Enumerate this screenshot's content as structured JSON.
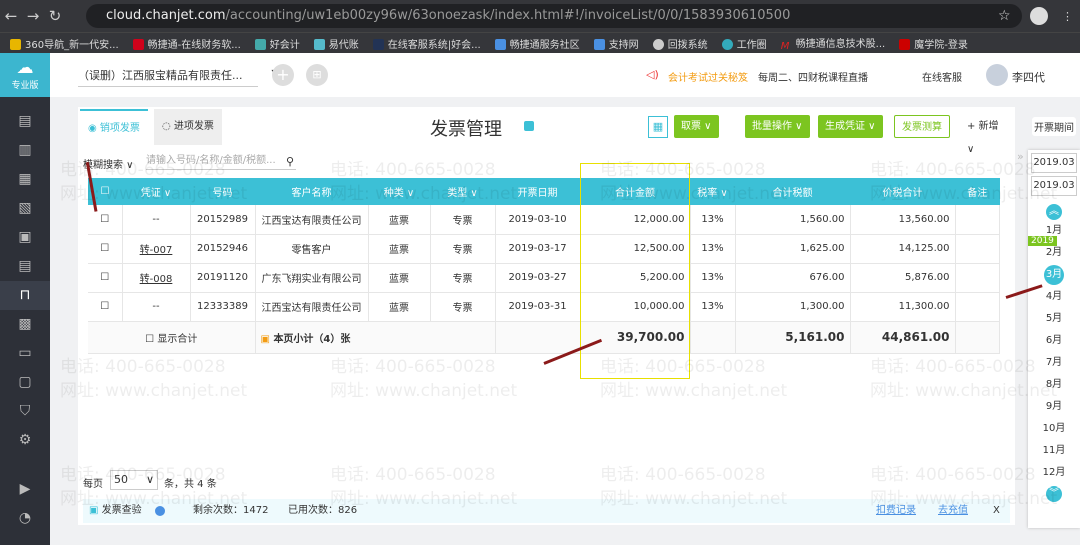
{
  "browser": {
    "url_host": "cloud.chanjet.com",
    "url_path": "/accounting/uw1eb00zy96w/63onoezask/index.html#!/invoiceList/0/0/1583930610500",
    "bookmarks": [
      "360导航_新一代安...",
      "畅捷通-在线财务软...",
      "好会计",
      "易代账",
      "在线客服系统|好会...",
      "畅捷通服务社区",
      "支持网",
      "回拨系统",
      "工作圈",
      "畅捷通信息技术股...",
      "魔学院-登录"
    ]
  },
  "app": {
    "edition": "专业版",
    "company": "（误删）江西服宝精品有限责任...",
    "promo1": "会计考试过关秘笈",
    "promo2": "每周二、四财税课程直播",
    "service": "在线客服",
    "user": "李四代"
  },
  "page": {
    "title": "发票管理",
    "tabs": [
      "销项发票",
      "进项发票"
    ],
    "buttons": {
      "fetch": "取票 ∨",
      "batch": "批量操作 ∨",
      "voucher": "生成凭证 ∨",
      "calc": "发票测算",
      "add": "+ 新增 ∨"
    },
    "search_label": "模糊搜索 ∨",
    "search_placeholder": "请输入号码/名称/金额/税额..."
  },
  "table": {
    "headers": [
      "凭证 ∨",
      "号码",
      "客户名称",
      "种类 ∨",
      "类型 ∨",
      "开票日期",
      "合计金额",
      "税率 ∨",
      "合计税额",
      "价税合计",
      "备注"
    ],
    "rows": [
      [
        "--",
        "20152989",
        "江西宝达有限责任公司",
        "蓝票",
        "专票",
        "2019-03-10",
        "12,000.00",
        "13%",
        "1,560.00",
        "13,560.00",
        ""
      ],
      [
        "转-007",
        "20152946",
        "零售客户",
        "蓝票",
        "专票",
        "2019-03-17",
        "12,500.00",
        "13%",
        "1,625.00",
        "14,125.00",
        ""
      ],
      [
        "转-008",
        "20191120",
        "广东飞翔实业有限公司",
        "蓝票",
        "专票",
        "2019-03-27",
        "5,200.00",
        "13%",
        "676.00",
        "5,876.00",
        ""
      ],
      [
        "--",
        "12333389",
        "江西宝达有限责任公司",
        "蓝票",
        "专票",
        "2019-03-31",
        "10,000.00",
        "13%",
        "1,300.00",
        "11,300.00",
        ""
      ]
    ],
    "show_total": "显示合计",
    "subtotal_label": "本页小计（4）张",
    "subtotal_amount": "39,700.00",
    "subtotal_tax": "5,161.00",
    "subtotal_total": "44,861.00"
  },
  "pager": {
    "per_page_label": "每页",
    "per_page": "50",
    "count": "条，共 4 条"
  },
  "footer": {
    "check": "发票查验",
    "remaining": "剩余次数：1472",
    "used": "已用次数：826",
    "record": "扣费记录",
    "recharge": "去充值",
    "close": "X"
  },
  "dates": {
    "label": "开票期间",
    "from": "2019.03",
    "to": "2019.03",
    "year": "2019",
    "months": [
      "1月",
      "2月",
      "3月",
      "4月",
      "5月",
      "6月",
      "7月",
      "8月",
      "9月",
      "10月",
      "11月",
      "12月"
    ]
  },
  "watermark": {
    "phone": "电话: 400-665-0028",
    "site": "网址: www.chanjet.net"
  }
}
